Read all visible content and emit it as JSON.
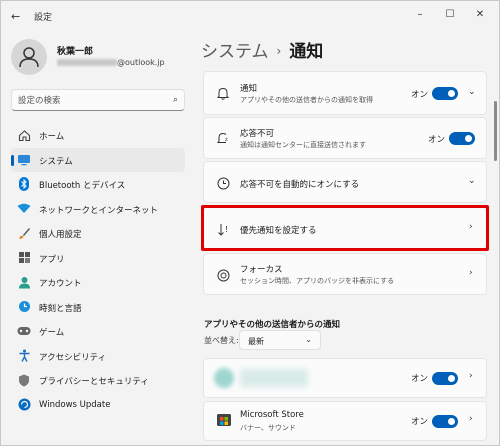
{
  "window": {
    "title": "設定",
    "back_icon": "back-arrow-icon",
    "controls": [
      "minimize-icon",
      "maximize-icon",
      "close-icon"
    ]
  },
  "profile": {
    "name": "秋葉一郎",
    "email_suffix": "@outlook.jp"
  },
  "search": {
    "placeholder": "設定の検索",
    "icon": "search-icon"
  },
  "nav": {
    "items": [
      {
        "label": "ホーム",
        "icon": "home-icon",
        "active": false
      },
      {
        "label": "システム",
        "icon": "system-display-icon",
        "active": true
      },
      {
        "label": "Bluetooth とデバイス",
        "icon": "bluetooth-icon",
        "active": false
      },
      {
        "label": "ネットワークとインターネット",
        "icon": "wifi-icon",
        "active": false
      },
      {
        "label": "個人用設定",
        "icon": "brush-icon",
        "active": false
      },
      {
        "label": "アプリ",
        "icon": "apps-icon",
        "active": false
      },
      {
        "label": "アカウント",
        "icon": "account-icon",
        "active": false
      },
      {
        "label": "時刻と言語",
        "icon": "globe-clock-icon",
        "active": false
      },
      {
        "label": "ゲーム",
        "icon": "gamepad-icon",
        "active": false
      },
      {
        "label": "アクセシビリティ",
        "icon": "accessibility-icon",
        "active": false
      },
      {
        "label": "プライバシーとセキュリティ",
        "icon": "shield-icon",
        "active": false
      },
      {
        "label": "Windows Update",
        "icon": "update-icon",
        "active": false
      }
    ]
  },
  "breadcrumb": {
    "parent": "システム",
    "separator": "›",
    "current": "通知"
  },
  "settings": {
    "notifications": {
      "title": "通知",
      "subtitle": "アプリやその他の送信者からの通知を取得",
      "toggle_label": "オン",
      "icon": "bell-icon"
    },
    "dnd": {
      "title": "応答不可",
      "subtitle": "通知は通知センターに直接送信されます",
      "toggle_label": "オン",
      "icon": "bell-snooze-icon"
    },
    "auto_dnd": {
      "title": "応答不可を自動的にオンにする",
      "icon": "clock-icon"
    },
    "priority": {
      "title": "優先通知を設定する",
      "icon": "priority-sort-icon"
    },
    "focus": {
      "title": "フォーカス",
      "subtitle": "セッション時間、アプリのバッジを非表示にする",
      "icon": "focus-icon"
    }
  },
  "apps_section": {
    "heading": "アプリやその他の送信者からの通知",
    "sort_label": "並べ替え:",
    "sort_value": "最新",
    "apps": [
      {
        "name": "",
        "subtitle": "",
        "toggle_label": "オン"
      },
      {
        "name": "Microsoft Store",
        "subtitle": "バナー、サウンド",
        "toggle_label": "オン"
      }
    ]
  },
  "colors": {
    "accent": "#005fb8",
    "highlight": "#e00000",
    "background": "#f3f3f3",
    "card": "#fbfbfb"
  }
}
